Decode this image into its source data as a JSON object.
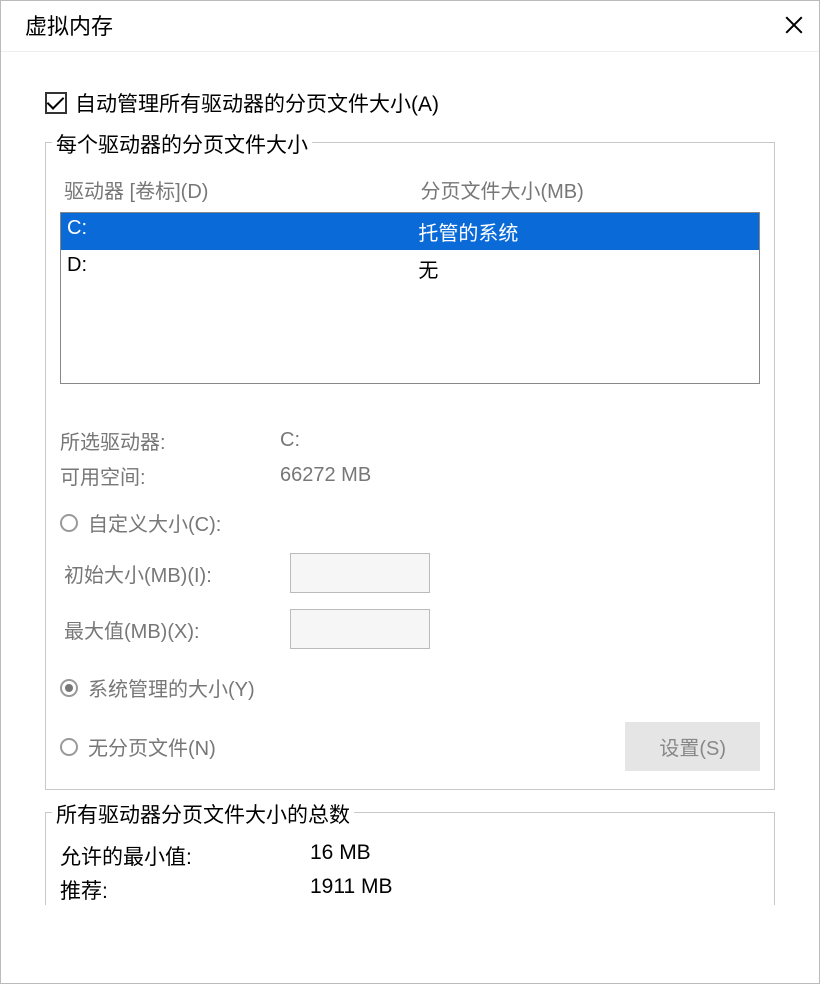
{
  "title": "虚拟内存",
  "auto_manage_label": "自动管理所有驱动器的分页文件大小(A)",
  "group1": {
    "title": "每个驱动器的分页文件大小",
    "col_drive": "驱动器 [卷标](D)",
    "col_size": "分页文件大小(MB)",
    "rows": [
      {
        "drive": "C:",
        "size": "托管的系统"
      },
      {
        "drive": "D:",
        "size": "无"
      }
    ],
    "selected_drive_label": "所选驱动器:",
    "selected_drive_value": "C:",
    "free_space_label": "可用空间:",
    "free_space_value": "66272 MB",
    "custom_size_label": "自定义大小(C):",
    "initial_label": "初始大小(MB)(I):",
    "max_label": "最大值(MB)(X):",
    "system_managed_label": "系统管理的大小(Y)",
    "no_paging_label": "无分页文件(N)",
    "set_button": "设置(S)"
  },
  "totals": {
    "title": "所有驱动器分页文件大小的总数",
    "min_label": "允许的最小值:",
    "min_value": "16 MB",
    "rec_label": "推荐:",
    "rec_value": "1911 MB"
  }
}
